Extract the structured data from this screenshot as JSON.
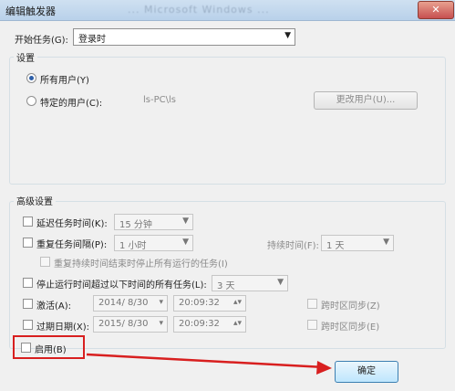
{
  "window": {
    "title": "编辑触发器",
    "blurred_title": "... Microsoft Windows ...",
    "close_glyph": "✕"
  },
  "begin_task": {
    "label": "开始任务(G):",
    "value": "登录时"
  },
  "settings": {
    "legend": "设置",
    "all_users_label": "所有用户(Y)",
    "specific_user_label": "特定的用户(C):",
    "specific_user_value": "ls-PC\\ls",
    "change_user_button": "更改用户(U)..."
  },
  "advanced": {
    "legend": "高级设置",
    "delay_label": "延迟任务时间(K):",
    "delay_value": "15 分钟",
    "repeat_label": "重复任务间隔(P):",
    "repeat_value": "1 小时",
    "duration_label": "持续时间(F):",
    "duration_value": "1 天",
    "stop_running_label": "重复持续时间结束时停止所有运行的任务(I)",
    "stop_if_longer_label": "停止运行时间超过以下时间的所有任务(L):",
    "stop_if_longer_value": "3 天",
    "activate_label": "激活(A):",
    "activate_date": "2014/ 8/30",
    "activate_time": "20:09:32",
    "activate_sync_label": "跨时区同步(Z)",
    "expire_label": "过期日期(X):",
    "expire_date": "2015/ 8/30",
    "expire_time": "20:09:32",
    "expire_sync_label": "跨时区同步(E)",
    "enabled_label": "启用(B)"
  },
  "footer": {
    "ok_label": "确定"
  },
  "icons": {
    "dropdown_arrow": "▼",
    "calendar_arrow": "▾",
    "spin_glyph": "▴▾"
  },
  "colors": {
    "highlight_red": "#d81f1f",
    "titlebar": "#b9d1ea",
    "radio_dot": "#2e5fa8"
  }
}
